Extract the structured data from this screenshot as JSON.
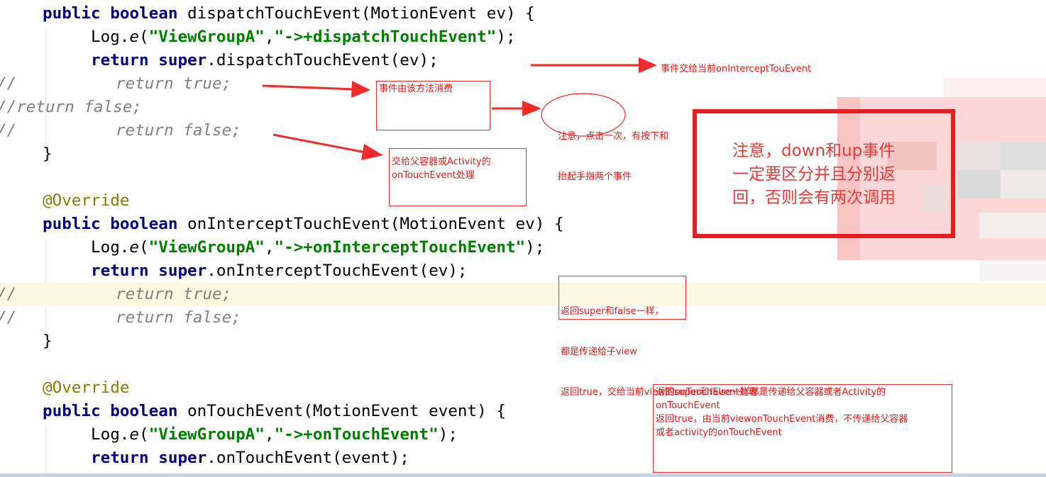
{
  "code_lines": [
    {
      "id": "l1",
      "parts": [
        {
          "c": "kw",
          "t": "public"
        },
        {
          "c": "",
          "t": " "
        },
        {
          "c": "kw",
          "t": "boolean"
        },
        {
          "c": "",
          "t": " dispatchTouchEvent(MotionEvent ev) {"
        }
      ]
    },
    {
      "id": "l2",
      "parts": [
        {
          "c": "",
          "t": "Log."
        },
        {
          "c": "fld",
          "t": "e"
        },
        {
          "c": "",
          "t": "("
        },
        {
          "c": "str",
          "t": "\"ViewGroupA\""
        },
        {
          "c": "",
          "t": ","
        },
        {
          "c": "str",
          "t": "\"->+dispatchTouchEvent\""
        },
        {
          "c": "",
          "t": ");"
        }
      ]
    },
    {
      "id": "l3",
      "parts": [
        {
          "c": "kw",
          "t": "return"
        },
        {
          "c": "",
          "t": " "
        },
        {
          "c": "kw",
          "t": "super"
        },
        {
          "c": "",
          "t": ".dispatchTouchEvent(ev);"
        }
      ]
    },
    {
      "id": "l4a",
      "parts": [
        {
          "c": "cm",
          "t": "//"
        }
      ]
    },
    {
      "id": "l4b",
      "parts": [
        {
          "c": "cm",
          "t": "return true;"
        }
      ]
    },
    {
      "id": "l5",
      "parts": [
        {
          "c": "cm",
          "t": "//return false;"
        }
      ]
    },
    {
      "id": "l6a",
      "parts": [
        {
          "c": "cm",
          "t": "//"
        }
      ]
    },
    {
      "id": "l6b",
      "parts": [
        {
          "c": "cm",
          "t": "return false;"
        }
      ]
    },
    {
      "id": "l7",
      "parts": [
        {
          "c": "",
          "t": "}"
        }
      ]
    },
    {
      "id": "l8",
      "parts": [
        {
          "c": "ann",
          "t": "@Override"
        }
      ]
    },
    {
      "id": "l9",
      "parts": [
        {
          "c": "kw",
          "t": "public"
        },
        {
          "c": "",
          "t": " "
        },
        {
          "c": "kw",
          "t": "boolean"
        },
        {
          "c": "",
          "t": " onInterceptTouchEvent(MotionEvent ev) {"
        }
      ]
    },
    {
      "id": "l10",
      "parts": [
        {
          "c": "",
          "t": "Log."
        },
        {
          "c": "fld",
          "t": "e"
        },
        {
          "c": "",
          "t": "("
        },
        {
          "c": "str",
          "t": "\"ViewGroupA\""
        },
        {
          "c": "",
          "t": ","
        },
        {
          "c": "str",
          "t": "\"->+onInterceptTouchEvent\""
        },
        {
          "c": "",
          "t": ");"
        }
      ]
    },
    {
      "id": "l11",
      "parts": [
        {
          "c": "kw",
          "t": "return"
        },
        {
          "c": "",
          "t": " "
        },
        {
          "c": "kw",
          "t": "super"
        },
        {
          "c": "",
          "t": ".onInterceptTouchEvent(ev);"
        }
      ]
    },
    {
      "id": "l12a",
      "parts": [
        {
          "c": "cm",
          "t": "//"
        }
      ]
    },
    {
      "id": "l12b",
      "parts": [
        {
          "c": "cm",
          "t": "return true;"
        }
      ]
    },
    {
      "id": "l13a",
      "parts": [
        {
          "c": "cm",
          "t": "//"
        }
      ]
    },
    {
      "id": "l13b",
      "parts": [
        {
          "c": "cm",
          "t": "return false;"
        }
      ]
    },
    {
      "id": "l14",
      "parts": [
        {
          "c": "",
          "t": "}"
        }
      ]
    },
    {
      "id": "l15",
      "parts": [
        {
          "c": "ann",
          "t": "@Override"
        }
      ]
    },
    {
      "id": "l16",
      "parts": [
        {
          "c": "kw",
          "t": "public"
        },
        {
          "c": "",
          "t": " "
        },
        {
          "c": "kw",
          "t": "boolean"
        },
        {
          "c": "",
          "t": " onTouchEvent(MotionEvent event) {"
        }
      ]
    },
    {
      "id": "l17",
      "parts": [
        {
          "c": "",
          "t": "Log."
        },
        {
          "c": "fld",
          "t": "e"
        },
        {
          "c": "",
          "t": "("
        },
        {
          "c": "str",
          "t": "\"ViewGroupA\""
        },
        {
          "c": "",
          "t": ","
        },
        {
          "c": "str",
          "t": "\"->+onTouchEvent\""
        },
        {
          "c": "",
          "t": ");"
        }
      ]
    },
    {
      "id": "l18",
      "parts": [
        {
          "c": "kw",
          "t": "return"
        },
        {
          "c": "",
          "t": " "
        },
        {
          "c": "kw",
          "t": "super"
        },
        {
          "c": "",
          "t": ".onTouchEvent(event);"
        }
      ]
    }
  ],
  "annotations": {
    "dispatch_super": "事件交给当前onInterceptTouEvent",
    "dispatch_true": "事件由该方法消费",
    "dispatch_note_1": "注意，点击一次，有按下和",
    "dispatch_note_2": "抬起手指两个事件",
    "dispatch_false_1": "交给父容器或Activity的",
    "dispatch_false_2": "onTouchEvent处理",
    "intercept_1": "返回super和false一样，",
    "intercept_2": "都是传递给子view",
    "intercept_3": "返回true，交给当前view的onTouchEvent处理",
    "touch_1": "返回super和false一样都是传递给父容器或者Activity的",
    "touch_2": "onTouchEvent",
    "touch_3": "返回true，由当前viewonTouchEvent消费，不传递给父容器",
    "touch_4": "或者activity的onTouchEvent",
    "big_1": "注意，down和up事件",
    "big_2": "一定要区分并且分别返",
    "big_3": "回，否则会有两次调用"
  },
  "colors": {
    "keyword": "#000080",
    "string": "#008000",
    "annotation": "#808000",
    "comment": "#808080",
    "note_red": "#e31a1a",
    "highlight_line": "#fdf8e0"
  }
}
